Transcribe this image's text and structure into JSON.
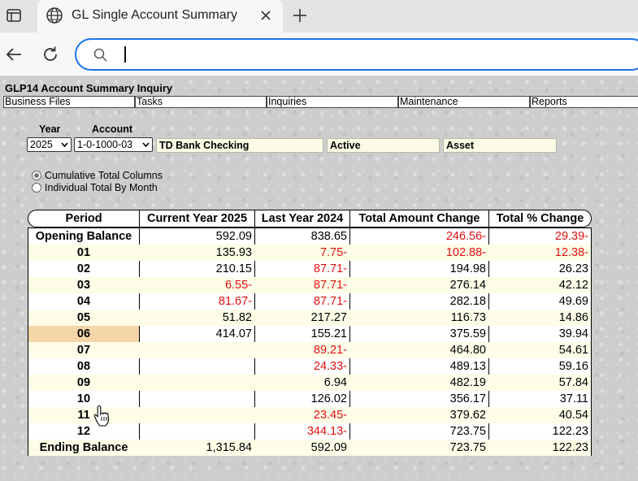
{
  "browser": {
    "tab_title": "GL Single Account Summary",
    "address_value": "",
    "icons": [
      "sidebar-icon",
      "globe-icon",
      "close-icon",
      "plus-icon",
      "back-arrow-icon",
      "reload-icon",
      "search-icon"
    ]
  },
  "app": {
    "title": "GLP14 Account Summary Inquiry",
    "menu": [
      "Business Files",
      "Tasks",
      "Inquiries",
      "Maintenance",
      "Reports"
    ]
  },
  "filters": {
    "year_label": "Year",
    "year_value": "2025",
    "account_label": "Account",
    "account_value": "1-0-1000-03",
    "account_description": "TD Bank Checking",
    "status": "Active",
    "account_type": "Asset"
  },
  "view_options": [
    {
      "label": "Cumulative Total Columns",
      "selected": true
    },
    {
      "label": "Individual Total By Month",
      "selected": false
    }
  ],
  "table": {
    "columns": [
      "Period",
      "Current Year 2025",
      "Last Year 2024",
      "Total Amount Change",
      "Total % Change"
    ],
    "rows": [
      {
        "period": "Opening Balance",
        "cy": "592.09",
        "ly": "838.65",
        "amt": "246.56-",
        "pct": "29.39-"
      },
      {
        "period": "01",
        "cy": "135.93",
        "ly": "7.75-",
        "amt": "102.88-",
        "pct": "12.38-"
      },
      {
        "period": "02",
        "cy": "210.15",
        "ly": "87.71-",
        "amt": "194.98",
        "pct": "26.23"
      },
      {
        "period": "03",
        "cy": "6.55-",
        "ly": "87.71-",
        "amt": "276.14",
        "pct": "42.12"
      },
      {
        "period": "04",
        "cy": "81.67-",
        "ly": "87.71-",
        "amt": "282.18",
        "pct": "49.69"
      },
      {
        "period": "05",
        "cy": "51.82",
        "ly": "217.27",
        "amt": "116.73",
        "pct": "14.86"
      },
      {
        "period": "06",
        "cy": "414.07",
        "ly": "155.21",
        "amt": "375.59",
        "pct": "39.94"
      },
      {
        "period": "07",
        "cy": "",
        "ly": "89.21-",
        "amt": "464.80",
        "pct": "54.61"
      },
      {
        "period": "08",
        "cy": "",
        "ly": "24.33-",
        "amt": "489.13",
        "pct": "59.16"
      },
      {
        "period": "09",
        "cy": "",
        "ly": "6.94",
        "amt": "482.19",
        "pct": "57.84"
      },
      {
        "period": "10",
        "cy": "",
        "ly": "126.02",
        "amt": "356.17",
        "pct": "37.11"
      },
      {
        "period": "11",
        "cy": "",
        "ly": "23.45-",
        "amt": "379.62",
        "pct": "40.54"
      },
      {
        "period": "12",
        "cy": "",
        "ly": "344.13-",
        "amt": "723.75",
        "pct": "122.23"
      },
      {
        "period": "Ending Balance",
        "cy": "1,315.84",
        "ly": "592.09",
        "amt": "723.75",
        "pct": "122.23"
      }
    ],
    "highlighted_period": "06",
    "colors": {
      "negative": "#e01010",
      "highlight": "#f5d6a8",
      "alt_row": "#fdfde8"
    }
  }
}
